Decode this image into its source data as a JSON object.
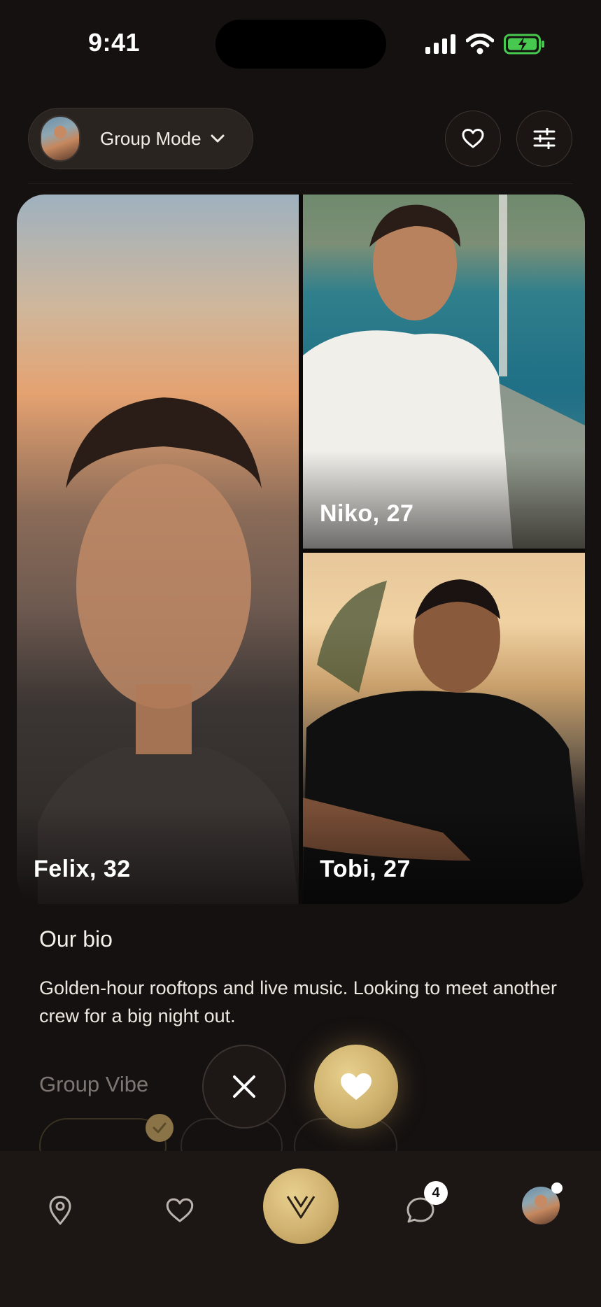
{
  "status_bar": {
    "time": "9:41"
  },
  "header": {
    "mode_label": "Group Mode",
    "icons": {
      "likes": "heart-icon",
      "filters": "sliders-icon"
    }
  },
  "profiles": [
    {
      "name_age": "Felix, 32"
    },
    {
      "name_age": "Niko, 27"
    },
    {
      "name_age": "Tobi, 27"
    }
  ],
  "bio": {
    "title": "Our bio",
    "text": "Golden-hour rooftops and live music. Looking to meet another crew for a big night out."
  },
  "group_vibe": {
    "title": "Group Vibe"
  },
  "actions": {
    "pass": "close-icon",
    "like": "heart-icon"
  },
  "tab_bar": {
    "items": [
      "location-pin-icon",
      "heart-icon",
      "app-logo-icon",
      "chat-icon",
      "profile-avatar"
    ],
    "messages_badge": "4"
  },
  "colors": {
    "accent_gold": "#cdb06c",
    "background": "#151110",
    "battery_green": "#46c94e"
  }
}
